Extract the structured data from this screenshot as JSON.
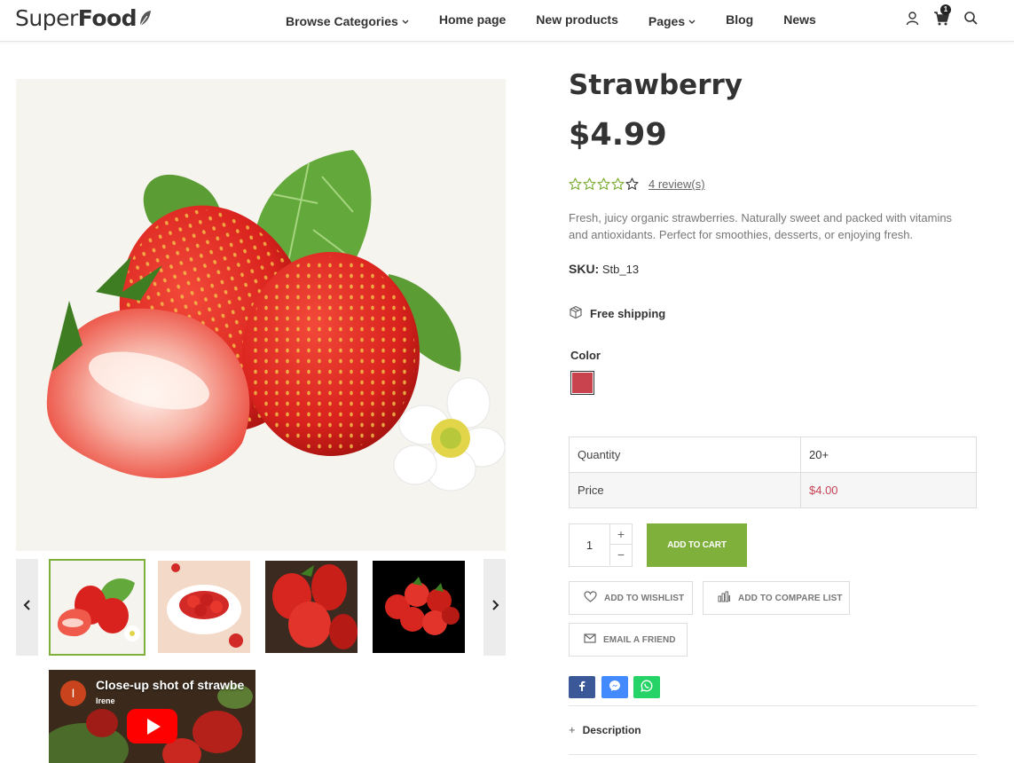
{
  "header": {
    "logo_light": "Super",
    "logo_bold": "Food",
    "nav": [
      {
        "label": "Browse Categories",
        "has_dropdown": true
      },
      {
        "label": "Home page",
        "has_dropdown": false
      },
      {
        "label": "New products",
        "has_dropdown": false
      },
      {
        "label": "Pages",
        "has_dropdown": true
      },
      {
        "label": "Blog",
        "has_dropdown": false
      },
      {
        "label": "News",
        "has_dropdown": false
      }
    ],
    "icons": [
      "user-icon",
      "cart-icon",
      "search-icon"
    ],
    "cart_count": "1"
  },
  "product": {
    "title": "Strawberry",
    "price": "$4.99",
    "rating": 4,
    "rating_max": 5,
    "review_link": "4 review(s)",
    "description": "Fresh, juicy organic strawberries. Naturally sweet and packed with vitamins and antioxidants. Perfect for smoothies, desserts, or enjoying fresh.",
    "sku_label": "SKU:",
    "sku_value": "Stb_13",
    "shipping": "Free shipping",
    "color_label": "Color",
    "color_swatch": "#c9434f"
  },
  "tier_table": {
    "rows": [
      {
        "label": "Quantity",
        "value": "20+"
      },
      {
        "label": "Price",
        "value": "$4.00"
      }
    ]
  },
  "cart": {
    "quantity": "1",
    "plus": "+",
    "minus": "−",
    "add_to_cart": "ADD TO CART"
  },
  "actions": {
    "wishlist": "ADD TO WISHLIST",
    "compare": "ADD TO COMPARE LIST",
    "email": "EMAIL A FRIEND"
  },
  "share": [
    "facebook-icon",
    "messenger-icon",
    "whatsapp-icon"
  ],
  "description_tab": {
    "toggle": "+",
    "label": "Description"
  },
  "video": {
    "title": "Close-up shot of strawbe",
    "channel": "Irene",
    "avatar_letter": "I"
  },
  "colors": {
    "accent_green": "#7fb03b",
    "price_red": "#c44356",
    "star_green": "#7fb03b"
  }
}
